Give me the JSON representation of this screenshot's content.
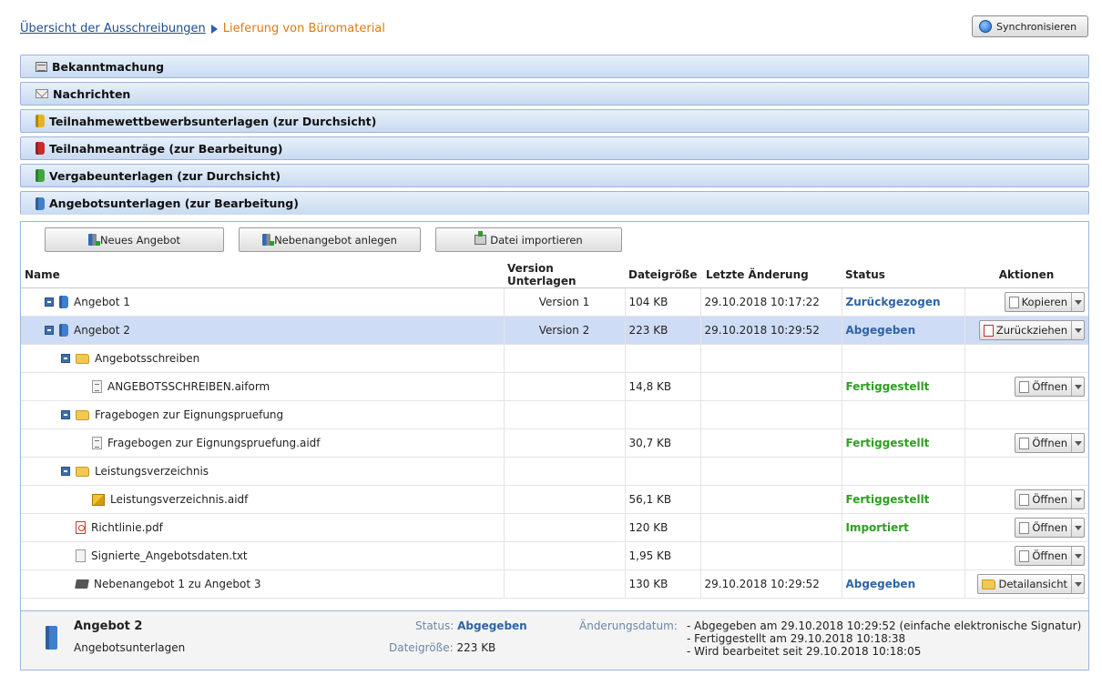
{
  "breadcrumb": {
    "link": "Übersicht der Ausschreibungen",
    "current": "Lieferung von Büromaterial"
  },
  "sync_button": "Synchronisieren",
  "sections": [
    {
      "label": "Bekanntmachung",
      "icon": "calendar-icon"
    },
    {
      "label": "Nachrichten",
      "icon": "envelope-icon"
    },
    {
      "label": "Teilnahmewettbewerbsunterlagen (zur Durchsicht)",
      "icon": "yellow-book-icon"
    },
    {
      "label": "Teilnahmeanträge (zur Bearbeitung)",
      "icon": "red-book-icon"
    },
    {
      "label": "Vergabeunterlagen (zur Durchsicht)",
      "icon": "green-book-icon"
    },
    {
      "label": "Angebotsunterlagen (zur Bearbeitung)",
      "icon": "blue-book-icon"
    }
  ],
  "toolbar": {
    "new_offer": "Neues Angebot",
    "side_offer": "Nebenangebot anlegen",
    "import_file": "Datei importieren"
  },
  "table": {
    "headers": {
      "name": "Name",
      "version": "Version Unterlagen",
      "size": "Dateigröße",
      "changed": "Letzte Änderung",
      "status": "Status",
      "actions": "Aktionen"
    },
    "rows": [
      {
        "name": "Angebot 1",
        "version": "Version 1",
        "size": "104 KB",
        "changed": "29.10.2018 10:17:22",
        "status": "Zurückgezogen",
        "action": "Kopieren"
      },
      {
        "name": "Angebot 2",
        "version": "Version 2",
        "size": "223 KB",
        "changed": "29.10.2018 10:29:52",
        "status": "Abgegeben",
        "action": "Zurückziehen"
      },
      {
        "name": "Angebotsschreiben",
        "version": "",
        "size": "",
        "changed": "",
        "status": "",
        "action": ""
      },
      {
        "name": "ANGEBOTSSCHREIBEN.aiform",
        "version": "",
        "size": "14,8 KB",
        "changed": "",
        "status": "Fertiggestellt",
        "action": "Öffnen"
      },
      {
        "name": "Fragebogen zur Eignungspruefung",
        "version": "",
        "size": "",
        "changed": "",
        "status": "",
        "action": ""
      },
      {
        "name": "Fragebogen zur Eignungspruefung.aidf",
        "version": "",
        "size": "30,7 KB",
        "changed": "",
        "status": "Fertiggestellt",
        "action": "Öffnen"
      },
      {
        "name": "Leistungsverzeichnis",
        "version": "",
        "size": "",
        "changed": "",
        "status": "",
        "action": ""
      },
      {
        "name": "Leistungsverzeichnis.aidf",
        "version": "",
        "size": "56,1 KB",
        "changed": "",
        "status": "Fertiggestellt",
        "action": "Öffnen"
      },
      {
        "name": "Richtlinie.pdf",
        "version": "",
        "size": "120 KB",
        "changed": "",
        "status": "Importiert",
        "action": "Öffnen"
      },
      {
        "name": "Signierte_Angebotsdaten.txt",
        "version": "",
        "size": "1,95 KB",
        "changed": "",
        "status": "",
        "action": "Öffnen"
      },
      {
        "name": "Nebenangebot 1 zu Angebot 3",
        "version": "",
        "size": "130 KB",
        "changed": "29.10.2018 10:29:52",
        "status": "Abgegeben",
        "action": "Detailansicht"
      }
    ]
  },
  "footer": {
    "title": "Angebot 2",
    "subtitle": "Angebotsunterlagen",
    "status_label": "Status:",
    "status_value": "Abgegeben",
    "size_label": "Dateigröße:",
    "size_value": "223 KB",
    "date_label": "Änderungsdatum:",
    "lines": [
      "- Abgegeben am 29.10.2018 10:29:52 (einfache elektronische Signatur)",
      "- Fertiggestellt am 29.10.2018 10:18:38",
      "- Wird bearbeitet seit 29.10.2018 10:18:05"
    ]
  },
  "colors": {
    "section_header": "#c9daf0",
    "selected_row": "#cfdcf5",
    "status_blue": "#2f64a5",
    "status_green": "#2f9e22",
    "breadcrumb_current": "#e07a12"
  }
}
